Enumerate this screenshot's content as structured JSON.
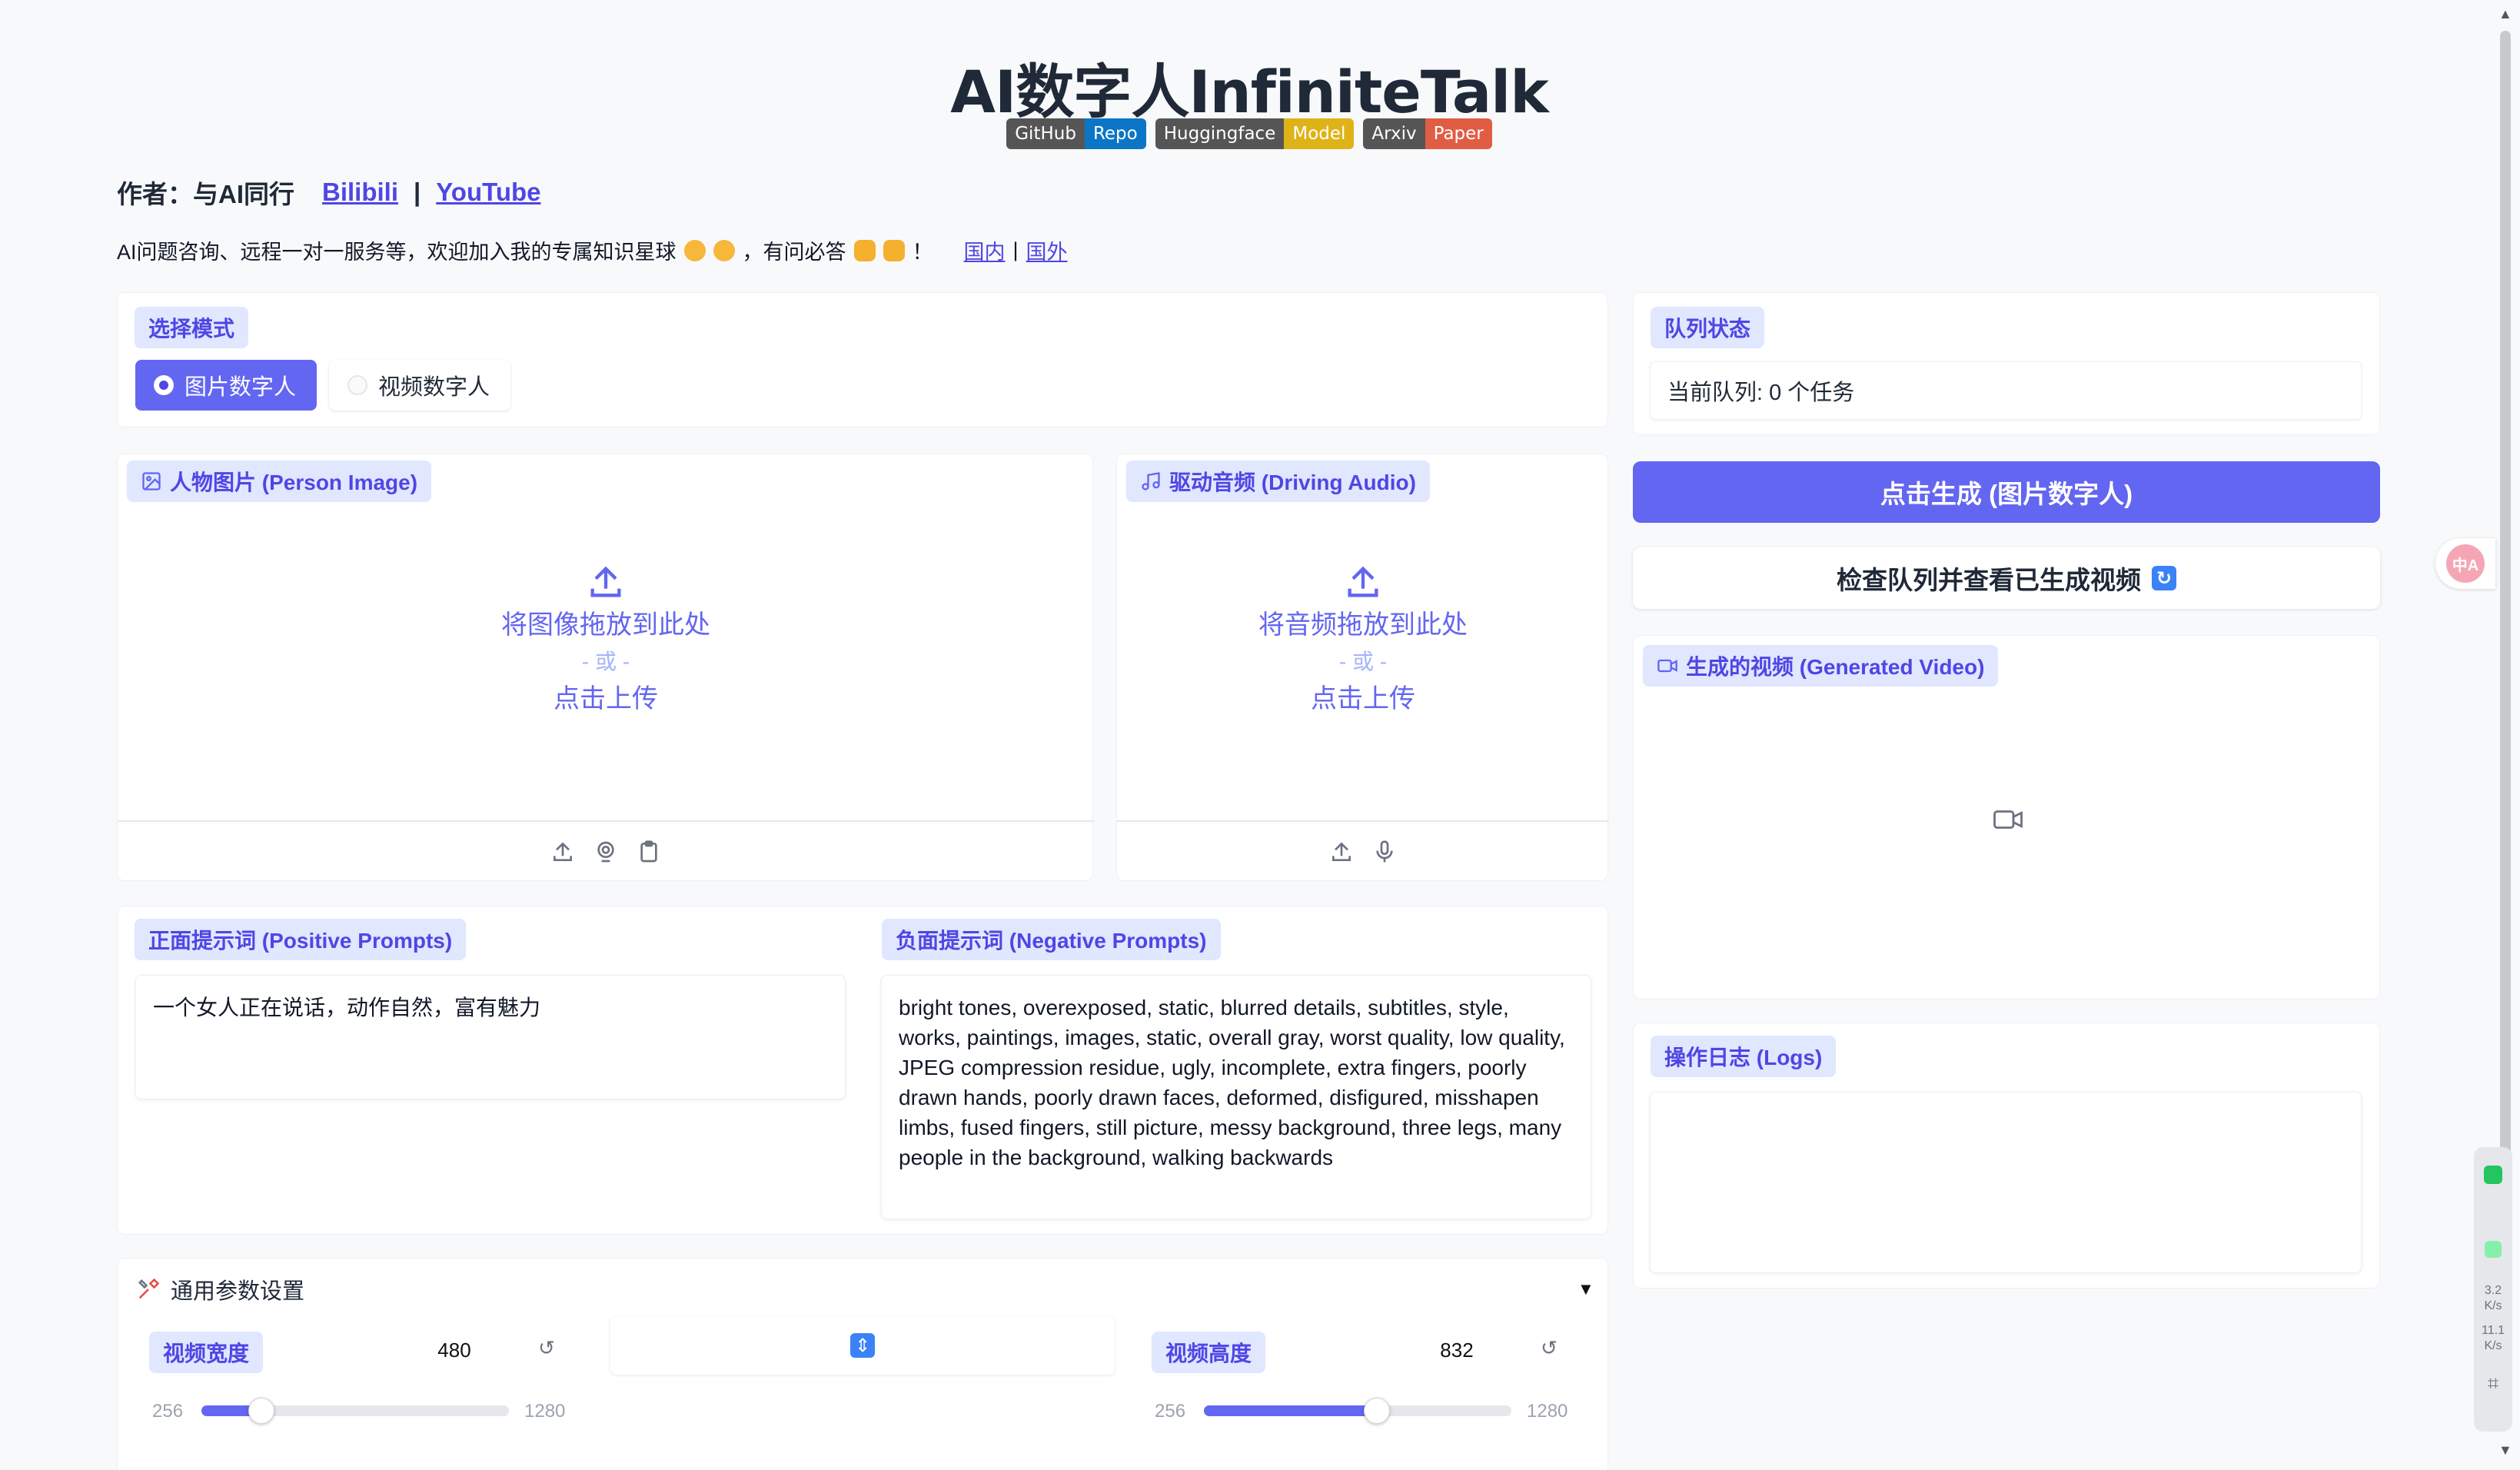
{
  "header": {
    "title": "AI数字人InfiniteTalk",
    "badges": [
      {
        "left": "GitHub",
        "right": "Repo",
        "color": "#0a76c5"
      },
      {
        "left": "Huggingface",
        "right": "Model",
        "color": "#dfb317"
      },
      {
        "left": "Arxiv",
        "right": "Paper",
        "color": "#e05d44"
      }
    ]
  },
  "author": {
    "label": "作者：与AI同行",
    "link1": "Bilibili",
    "separator": "|",
    "link2": "YouTube"
  },
  "promo": {
    "text": "AI问题咨询、远程一对一服务等，欢迎加入我的专属知识星球",
    "mid": "，有问必答",
    "end": "！",
    "link_domestic": "国内",
    "separator": "|",
    "link_abroad": "国外"
  },
  "mode": {
    "label": "选择模式",
    "options": [
      "图片数字人",
      "视频数字人"
    ],
    "selected": "图片数字人"
  },
  "queue": {
    "label": "队列状态",
    "status": "当前队列: 0 个任务"
  },
  "person_image": {
    "label": "人物图片 (Person Image)",
    "drop": "将图像拖放到此处",
    "or": "- 或 -",
    "click": "点击上传"
  },
  "driving_audio": {
    "label": "驱动音频 (Driving Audio)",
    "drop": "将音频拖放到此处",
    "or": "- 或 -",
    "click": "点击上传"
  },
  "actions": {
    "generate": "点击生成 (图片数字人)",
    "check_queue": "检查队列并查看已生成视频"
  },
  "generated_video": {
    "label": "生成的视频 (Generated Video)"
  },
  "prompts": {
    "positive_label": "正面提示词 (Positive Prompts)",
    "positive_value": "一个女人正在说话，动作自然，富有魅力",
    "negative_label": "负面提示词 (Negative Prompts)",
    "negative_value": "bright tones, overexposed, static, blurred details, subtitles, style, works, paintings, images, static, overall gray, worst quality, low quality, JPEG compression residue, ugly, incomplete, extra fingers, poorly drawn hands, poorly drawn faces, deformed, disfigured, misshapen limbs, fused fingers, still picture, messy background, three legs, many people in the background, walking backwards"
  },
  "logs": {
    "label": "操作日志 (Logs)"
  },
  "settings": {
    "title": "通用参数设置",
    "caret": "▼",
    "width": {
      "label": "视频宽度",
      "value": "480",
      "min": "256",
      "max": "1280",
      "fraction": 0.196
    },
    "height": {
      "label": "视频高度",
      "value": "832",
      "min": "256",
      "max": "1280",
      "fraction": 0.5625
    }
  },
  "side": {
    "translate": "中A",
    "net_up": "3.2",
    "net_up_unit": "K/s",
    "net_down": "11.1",
    "net_down_unit": "K/s"
  },
  "colors": {
    "accent": "#6366f1",
    "chip_bg": "#e0e7ff"
  }
}
